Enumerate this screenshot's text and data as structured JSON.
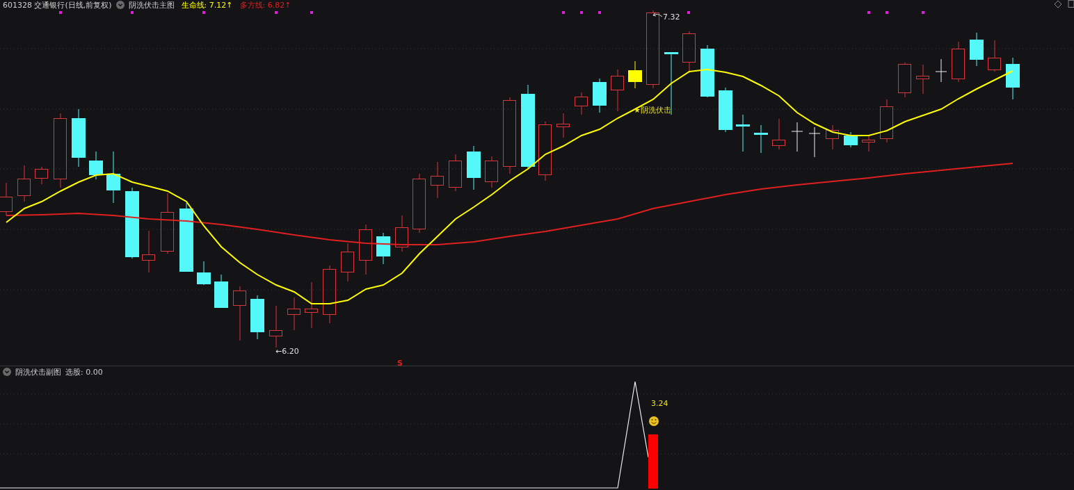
{
  "main_panel": {
    "security": "601328 交通银行(日线,前复权)",
    "indicator": "阴洗伏击主图",
    "lines": [
      {
        "label": "生命线:",
        "value": "7.12",
        "arrow": "↑",
        "color": "#ffff00"
      },
      {
        "label": "多方线:",
        "value": "6.82",
        "arrow": "↑",
        "color": "#e02020"
      }
    ],
    "high_label": "7.32",
    "low_label": "←6.20",
    "signal_label": "★阴洗伏击",
    "buy_marker": "S"
  },
  "sub_panel": {
    "indicator": "阴洗伏击副图",
    "reading": "选股: 0.00",
    "value_label": "3.24"
  }
}
